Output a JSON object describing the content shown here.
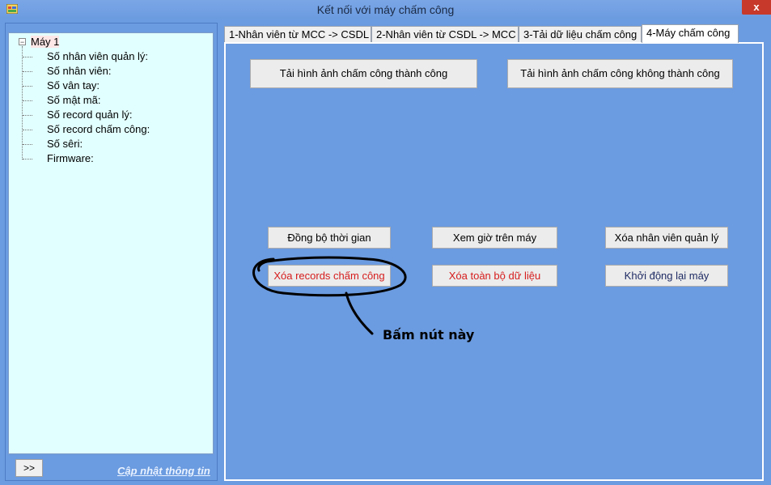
{
  "window": {
    "title": "Kết nối với máy chấm công",
    "close_glyph": "x",
    "icon": "app-window-icon"
  },
  "sidebar": {
    "root": {
      "toggle": "−",
      "label": "Máy 1"
    },
    "items": [
      {
        "label": "Số nhân viên quản lý:"
      },
      {
        "label": "Số nhân viên:"
      },
      {
        "label": "Số vân tay:"
      },
      {
        "label": "Số mật mã:"
      },
      {
        "label": "Số record quản lý:"
      },
      {
        "label": "Số record chấm công:"
      },
      {
        "label": "Số sêri:"
      },
      {
        "label": "Firmware:"
      }
    ],
    "expand_button": ">>",
    "update_link": "Cập nhật thông tin"
  },
  "tabs": [
    {
      "label": "1-Nhân viên từ MCC -> CSDL",
      "active": false
    },
    {
      "label": "2-Nhân viên từ CSDL -> MCC",
      "active": false
    },
    {
      "label": "3-Tải dữ liệu chấm công",
      "active": false
    },
    {
      "label": "4-Máy chấm công",
      "active": true
    }
  ],
  "panel": {
    "download_success": "Tải hình ảnh chấm công thành công",
    "download_fail": "Tải hình ảnh chấm công không thành công",
    "sync_time": "Đồng bộ thời gian",
    "view_time": "Xem giờ trên máy",
    "delete_admin": "Xóa nhân viên quản lý",
    "delete_records": "Xóa records chấm công",
    "delete_all": "Xóa toàn bộ dữ liệu",
    "restart": "Khởi động lại máy"
  },
  "annotation": {
    "text": "Bấm nút này"
  },
  "colors": {
    "background": "#6b9be0",
    "tree_background": "#e2ffff",
    "danger_text": "#d61c1c",
    "close_button": "#c7392a"
  }
}
